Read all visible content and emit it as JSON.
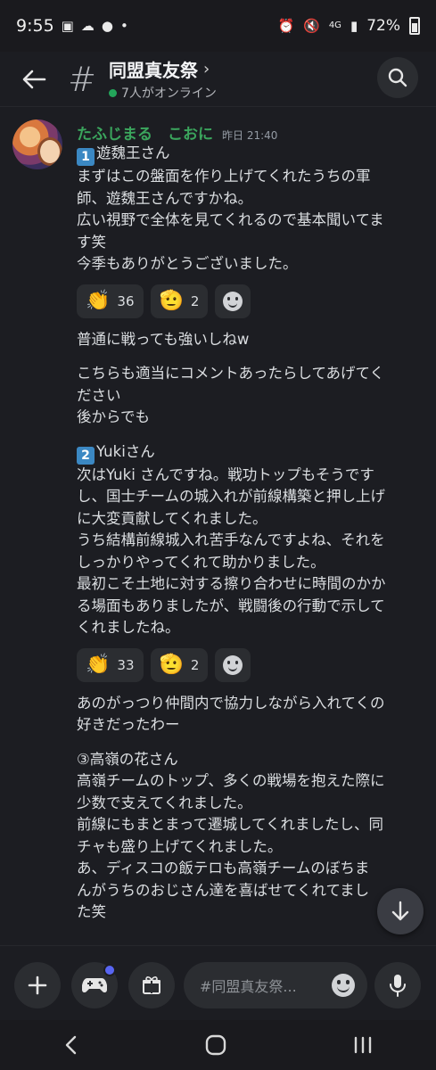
{
  "status_bar": {
    "time": "9:55",
    "network": "4G",
    "battery": "72%"
  },
  "header": {
    "title": "同盟真友祭",
    "online": "7人がオンライン"
  },
  "message": {
    "author": "たふじまる　こおに",
    "timestamp": "昨日 21:40",
    "sec1": {
      "num": "1",
      "title": "遊魏王さん",
      "lines": [
        "まずはこの盤面を作り上げてくれたうちの軍",
        "師、遊魏王さんですかね。",
        "広い視野で全体を見てくれるので基本聞いてま",
        "す笑",
        "今季もありがとうございました。"
      ],
      "reactions": [
        {
          "emoji": "clap",
          "count": "36"
        },
        {
          "emoji": "salute",
          "count": "2"
        }
      ]
    },
    "extra1": [
      "普通に戦っても強いしねw"
    ],
    "extra2": [
      "こちらも適当にコメントあったらしてあげてく",
      "ださい",
      "後からでも"
    ],
    "sec2": {
      "num": "2",
      "title": "Yukiさん",
      "lines": [
        "次はYuki さんですね。戦功トップもそうです",
        "し、国士チームの城入れが前線構築と押し上げ",
        "に大変貢献してくれました。",
        "うち結構前線城入れ苦手なんですよね、それを",
        "しっかりやってくれて助かりました。",
        "最初こそ土地に対する擦り合わせに時間のかか",
        "る場面もありましたが、戦闘後の行動で示して",
        "くれましたね。"
      ],
      "reactions": [
        {
          "emoji": "clap",
          "count": "33"
        },
        {
          "emoji": "salute",
          "count": "2"
        }
      ]
    },
    "extra3": [
      "あのがっつり仲間内で協力しながら入れてくの",
      "好きだったわー"
    ],
    "sec3": {
      "title": "③高嶺の花さん",
      "lines": [
        "高嶺チームのトップ、多くの戦場を抱えた際に",
        "少数で支えてくれました。",
        "前線にもまとまって遷城してくれましたし、同",
        "チャも盛り上げてくれました。",
        "あ、ディスコの飯テロも高嶺チームのぼちま",
        "んがうちのおじさん達を喜ばせてくれてまし",
        "た笑"
      ]
    }
  },
  "composer": {
    "placeholder": "#同盟真友祭..."
  },
  "colors": {
    "author": "#3ba55d",
    "online": "#23a55a",
    "accent": "#5865f2",
    "number_badge": "#3b88c3"
  }
}
